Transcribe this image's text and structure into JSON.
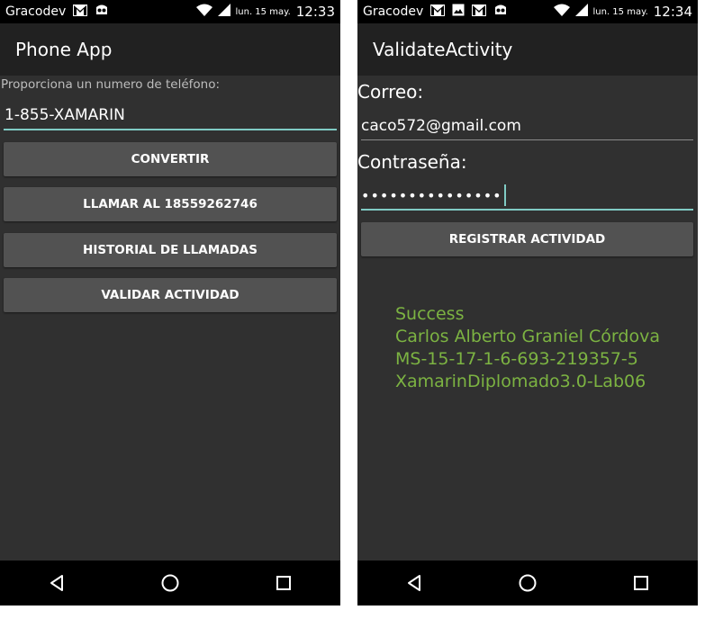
{
  "left_screen": {
    "status_bar": {
      "carrier": "Gracodev",
      "date": "lun. 15 may.",
      "time": "12:33"
    },
    "title": "Phone App",
    "prompt_label": "Proporciona un numero de teléfono:",
    "phone_input_value": "1-855-XAMARIN",
    "buttons": {
      "convert": "CONVERTIR",
      "call": "LLAMAR AL 18559262746",
      "history": "HISTORIAL DE LLAMADAS",
      "validate": "VALIDAR ACTIVIDAD"
    }
  },
  "right_screen": {
    "status_bar": {
      "carrier": "Gracodev",
      "date": "lun. 15 may.",
      "time": "12:34"
    },
    "title": "ValidateActivity",
    "email_label": "Correo:",
    "email_value": "caco572@gmail.com",
    "password_label": "Contraseña:",
    "password_mask": "•••••••••••••••",
    "register_button": "REGISTRAR ACTIVIDAD",
    "result_lines": {
      "status": "Success",
      "name": "Carlos Alberto Graniel Córdova",
      "device": "MS-15-17-1-6-693-219357-5",
      "lab": "XamarinDiplomado3.0-Lab06"
    }
  },
  "colors": {
    "accent": "#80cbc4",
    "success_text": "#7cb342",
    "button_bg": "#525252",
    "action_bar_bg": "#212121",
    "screen_bg": "#303030"
  },
  "icons": [
    "gmail-icon",
    "android-debug-icon",
    "wifi-icon",
    "signal-icon",
    "battery-icon",
    "image-icon",
    "back-icon",
    "home-icon",
    "recents-icon"
  ]
}
